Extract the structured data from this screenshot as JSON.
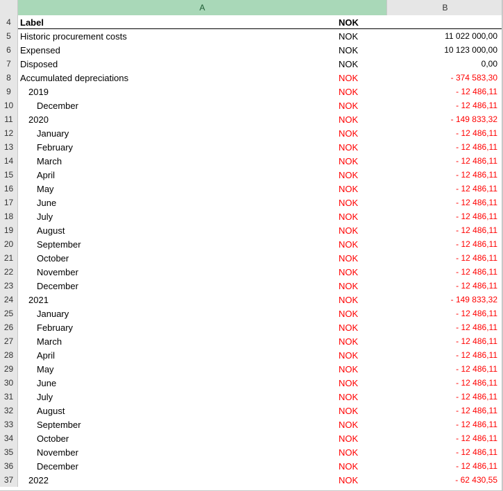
{
  "columns": {
    "a": "A",
    "b": "B"
  },
  "colors": {
    "negative": "#ff0000",
    "header_selected": "#a9d8b8"
  },
  "rows": [
    {
      "num": "4",
      "label": "Label",
      "level": 0,
      "currency": "NOK",
      "value": "",
      "negative": false,
      "header": true
    },
    {
      "num": "5",
      "label": "Historic procurement costs",
      "level": 0,
      "currency": "NOK",
      "value": "11 022 000,00",
      "negative": false
    },
    {
      "num": "6",
      "label": "Expensed",
      "level": 0,
      "currency": "NOK",
      "value": "10 123 000,00",
      "negative": false
    },
    {
      "num": "7",
      "label": "Disposed",
      "level": 0,
      "currency": "NOK",
      "value": "0,00",
      "negative": false
    },
    {
      "num": "8",
      "label": "Accumulated depreciations",
      "level": 0,
      "currency": "NOK",
      "value": "- 374 583,30",
      "negative": true
    },
    {
      "num": "9",
      "label": "2019",
      "level": 1,
      "currency": "NOK",
      "value": "- 12 486,11",
      "negative": true
    },
    {
      "num": "10",
      "label": "December",
      "level": 2,
      "currency": "NOK",
      "value": "- 12 486,11",
      "negative": true
    },
    {
      "num": "11",
      "label": "2020",
      "level": 1,
      "currency": "NOK",
      "value": "- 149 833,32",
      "negative": true
    },
    {
      "num": "12",
      "label": "January",
      "level": 2,
      "currency": "NOK",
      "value": "- 12 486,11",
      "negative": true
    },
    {
      "num": "13",
      "label": "February",
      "level": 2,
      "currency": "NOK",
      "value": "- 12 486,11",
      "negative": true
    },
    {
      "num": "14",
      "label": "March",
      "level": 2,
      "currency": "NOK",
      "value": "- 12 486,11",
      "negative": true
    },
    {
      "num": "15",
      "label": "April",
      "level": 2,
      "currency": "NOK",
      "value": "- 12 486,11",
      "negative": true
    },
    {
      "num": "16",
      "label": "May",
      "level": 2,
      "currency": "NOK",
      "value": "- 12 486,11",
      "negative": true
    },
    {
      "num": "17",
      "label": "June",
      "level": 2,
      "currency": "NOK",
      "value": "- 12 486,11",
      "negative": true
    },
    {
      "num": "18",
      "label": "July",
      "level": 2,
      "currency": "NOK",
      "value": "- 12 486,11",
      "negative": true
    },
    {
      "num": "19",
      "label": "August",
      "level": 2,
      "currency": "NOK",
      "value": "- 12 486,11",
      "negative": true
    },
    {
      "num": "20",
      "label": "September",
      "level": 2,
      "currency": "NOK",
      "value": "- 12 486,11",
      "negative": true
    },
    {
      "num": "21",
      "label": "October",
      "level": 2,
      "currency": "NOK",
      "value": "- 12 486,11",
      "negative": true
    },
    {
      "num": "22",
      "label": "November",
      "level": 2,
      "currency": "NOK",
      "value": "- 12 486,11",
      "negative": true
    },
    {
      "num": "23",
      "label": "December",
      "level": 2,
      "currency": "NOK",
      "value": "- 12 486,11",
      "negative": true
    },
    {
      "num": "24",
      "label": "2021",
      "level": 1,
      "currency": "NOK",
      "value": "- 149 833,32",
      "negative": true
    },
    {
      "num": "25",
      "label": "January",
      "level": 2,
      "currency": "NOK",
      "value": "- 12 486,11",
      "negative": true
    },
    {
      "num": "26",
      "label": "February",
      "level": 2,
      "currency": "NOK",
      "value": "- 12 486,11",
      "negative": true
    },
    {
      "num": "27",
      "label": "March",
      "level": 2,
      "currency": "NOK",
      "value": "- 12 486,11",
      "negative": true
    },
    {
      "num": "28",
      "label": "April",
      "level": 2,
      "currency": "NOK",
      "value": "- 12 486,11",
      "negative": true
    },
    {
      "num": "29",
      "label": "May",
      "level": 2,
      "currency": "NOK",
      "value": "- 12 486,11",
      "negative": true
    },
    {
      "num": "30",
      "label": "June",
      "level": 2,
      "currency": "NOK",
      "value": "- 12 486,11",
      "negative": true
    },
    {
      "num": "31",
      "label": "July",
      "level": 2,
      "currency": "NOK",
      "value": "- 12 486,11",
      "negative": true
    },
    {
      "num": "32",
      "label": "August",
      "level": 2,
      "currency": "NOK",
      "value": "- 12 486,11",
      "negative": true
    },
    {
      "num": "33",
      "label": "September",
      "level": 2,
      "currency": "NOK",
      "value": "- 12 486,11",
      "negative": true
    },
    {
      "num": "34",
      "label": "October",
      "level": 2,
      "currency": "NOK",
      "value": "- 12 486,11",
      "negative": true
    },
    {
      "num": "35",
      "label": "November",
      "level": 2,
      "currency": "NOK",
      "value": "- 12 486,11",
      "negative": true
    },
    {
      "num": "36",
      "label": "December",
      "level": 2,
      "currency": "NOK",
      "value": "- 12 486,11",
      "negative": true
    },
    {
      "num": "37",
      "label": "2022",
      "level": 1,
      "currency": "NOK",
      "value": "- 62 430,55",
      "negative": true
    }
  ]
}
